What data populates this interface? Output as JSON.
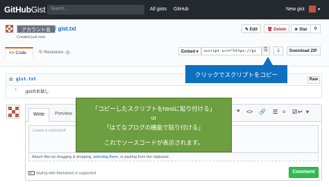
{
  "header": {
    "logo_bold": "GitHub",
    "logo_light": "Gist",
    "search_placeholder": "Search...",
    "nav": [
      "All gists",
      "GitHub"
    ],
    "new_gist": "New gist"
  },
  "gist": {
    "account_name": "アカウント名",
    "separator": "/",
    "filename": "gist.txt",
    "created": "Created just now",
    "actions": {
      "edit": "Edit",
      "delete": "Delete",
      "star": "Star",
      "star_count": "0"
    }
  },
  "tabs": {
    "code": "Code",
    "revisions": "Revisions",
    "revisions_count": "1"
  },
  "embed": {
    "select_label": "Embed",
    "input_value": "<script src=\"https://gi",
    "download_zip": "Download ZIP"
  },
  "tooltip": "クリックでスクリプトをコピー",
  "file": {
    "name": "gist.txt",
    "raw": "Raw",
    "lines": [
      {
        "number": "1",
        "text": "gistのお試し"
      }
    ]
  },
  "comment": {
    "write_tab": "Write",
    "preview_tab": "Preview",
    "placeholder": "Leave a comment",
    "attach_prefix": "Attach files by dragging & dropping, ",
    "attach_link": "selecting them",
    "attach_suffix": ", or pasting from the clipboard.",
    "markdown_note": "Styling with Markdown is supported",
    "submit": "Comment"
  },
  "overlay": {
    "line1": "「コピーしたスクリプトをhtmlに貼り付ける」",
    "line2": "or",
    "line3": "「はてなブログの機能で貼り付ける」",
    "line4": "これでソースコードが表示されます。"
  },
  "colors": {
    "topbar": "#24292e",
    "tooltip": "#0d70c0",
    "overlay": "#6d9e3f",
    "comment_button": "#2cbe4e",
    "link": "#0366d6"
  }
}
